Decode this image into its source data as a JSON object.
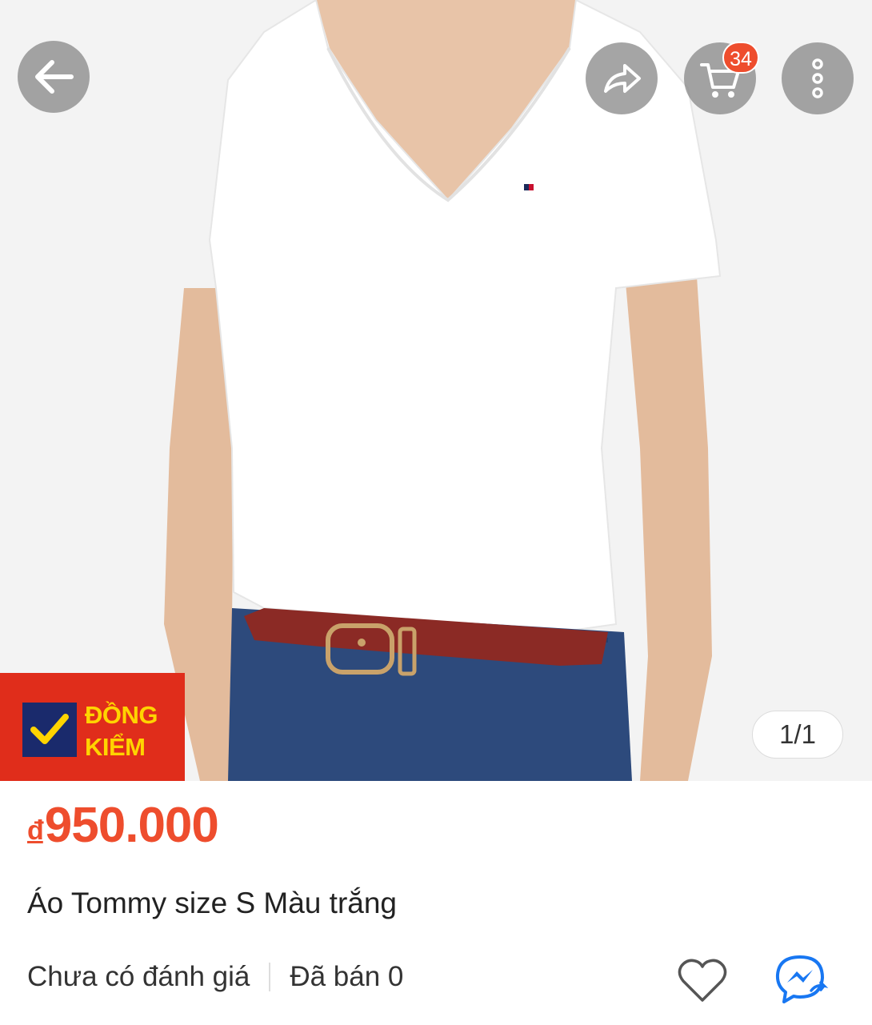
{
  "header": {
    "back": "back-arrow-icon",
    "share": "share-icon",
    "cart": "cart-icon",
    "more": "more-options-icon",
    "cart_count": "34"
  },
  "gallery": {
    "badge_line1": "ĐỒNG",
    "badge_line2": "KIỂM",
    "counter": "1/1"
  },
  "product": {
    "currency": "đ",
    "price": "950.000",
    "title": "Áo Tommy size S Màu trắng",
    "rating_text": "Chưa có đánh giá",
    "sold_text": "Đã bán 0"
  },
  "actions": {
    "like": "heart-icon",
    "chat": "messenger-icon"
  },
  "colors": {
    "accent": "#ee4d2d",
    "badge_bg": "#e02d1b",
    "badge_text": "#ffd400",
    "check_box": "#1a2a6c"
  }
}
